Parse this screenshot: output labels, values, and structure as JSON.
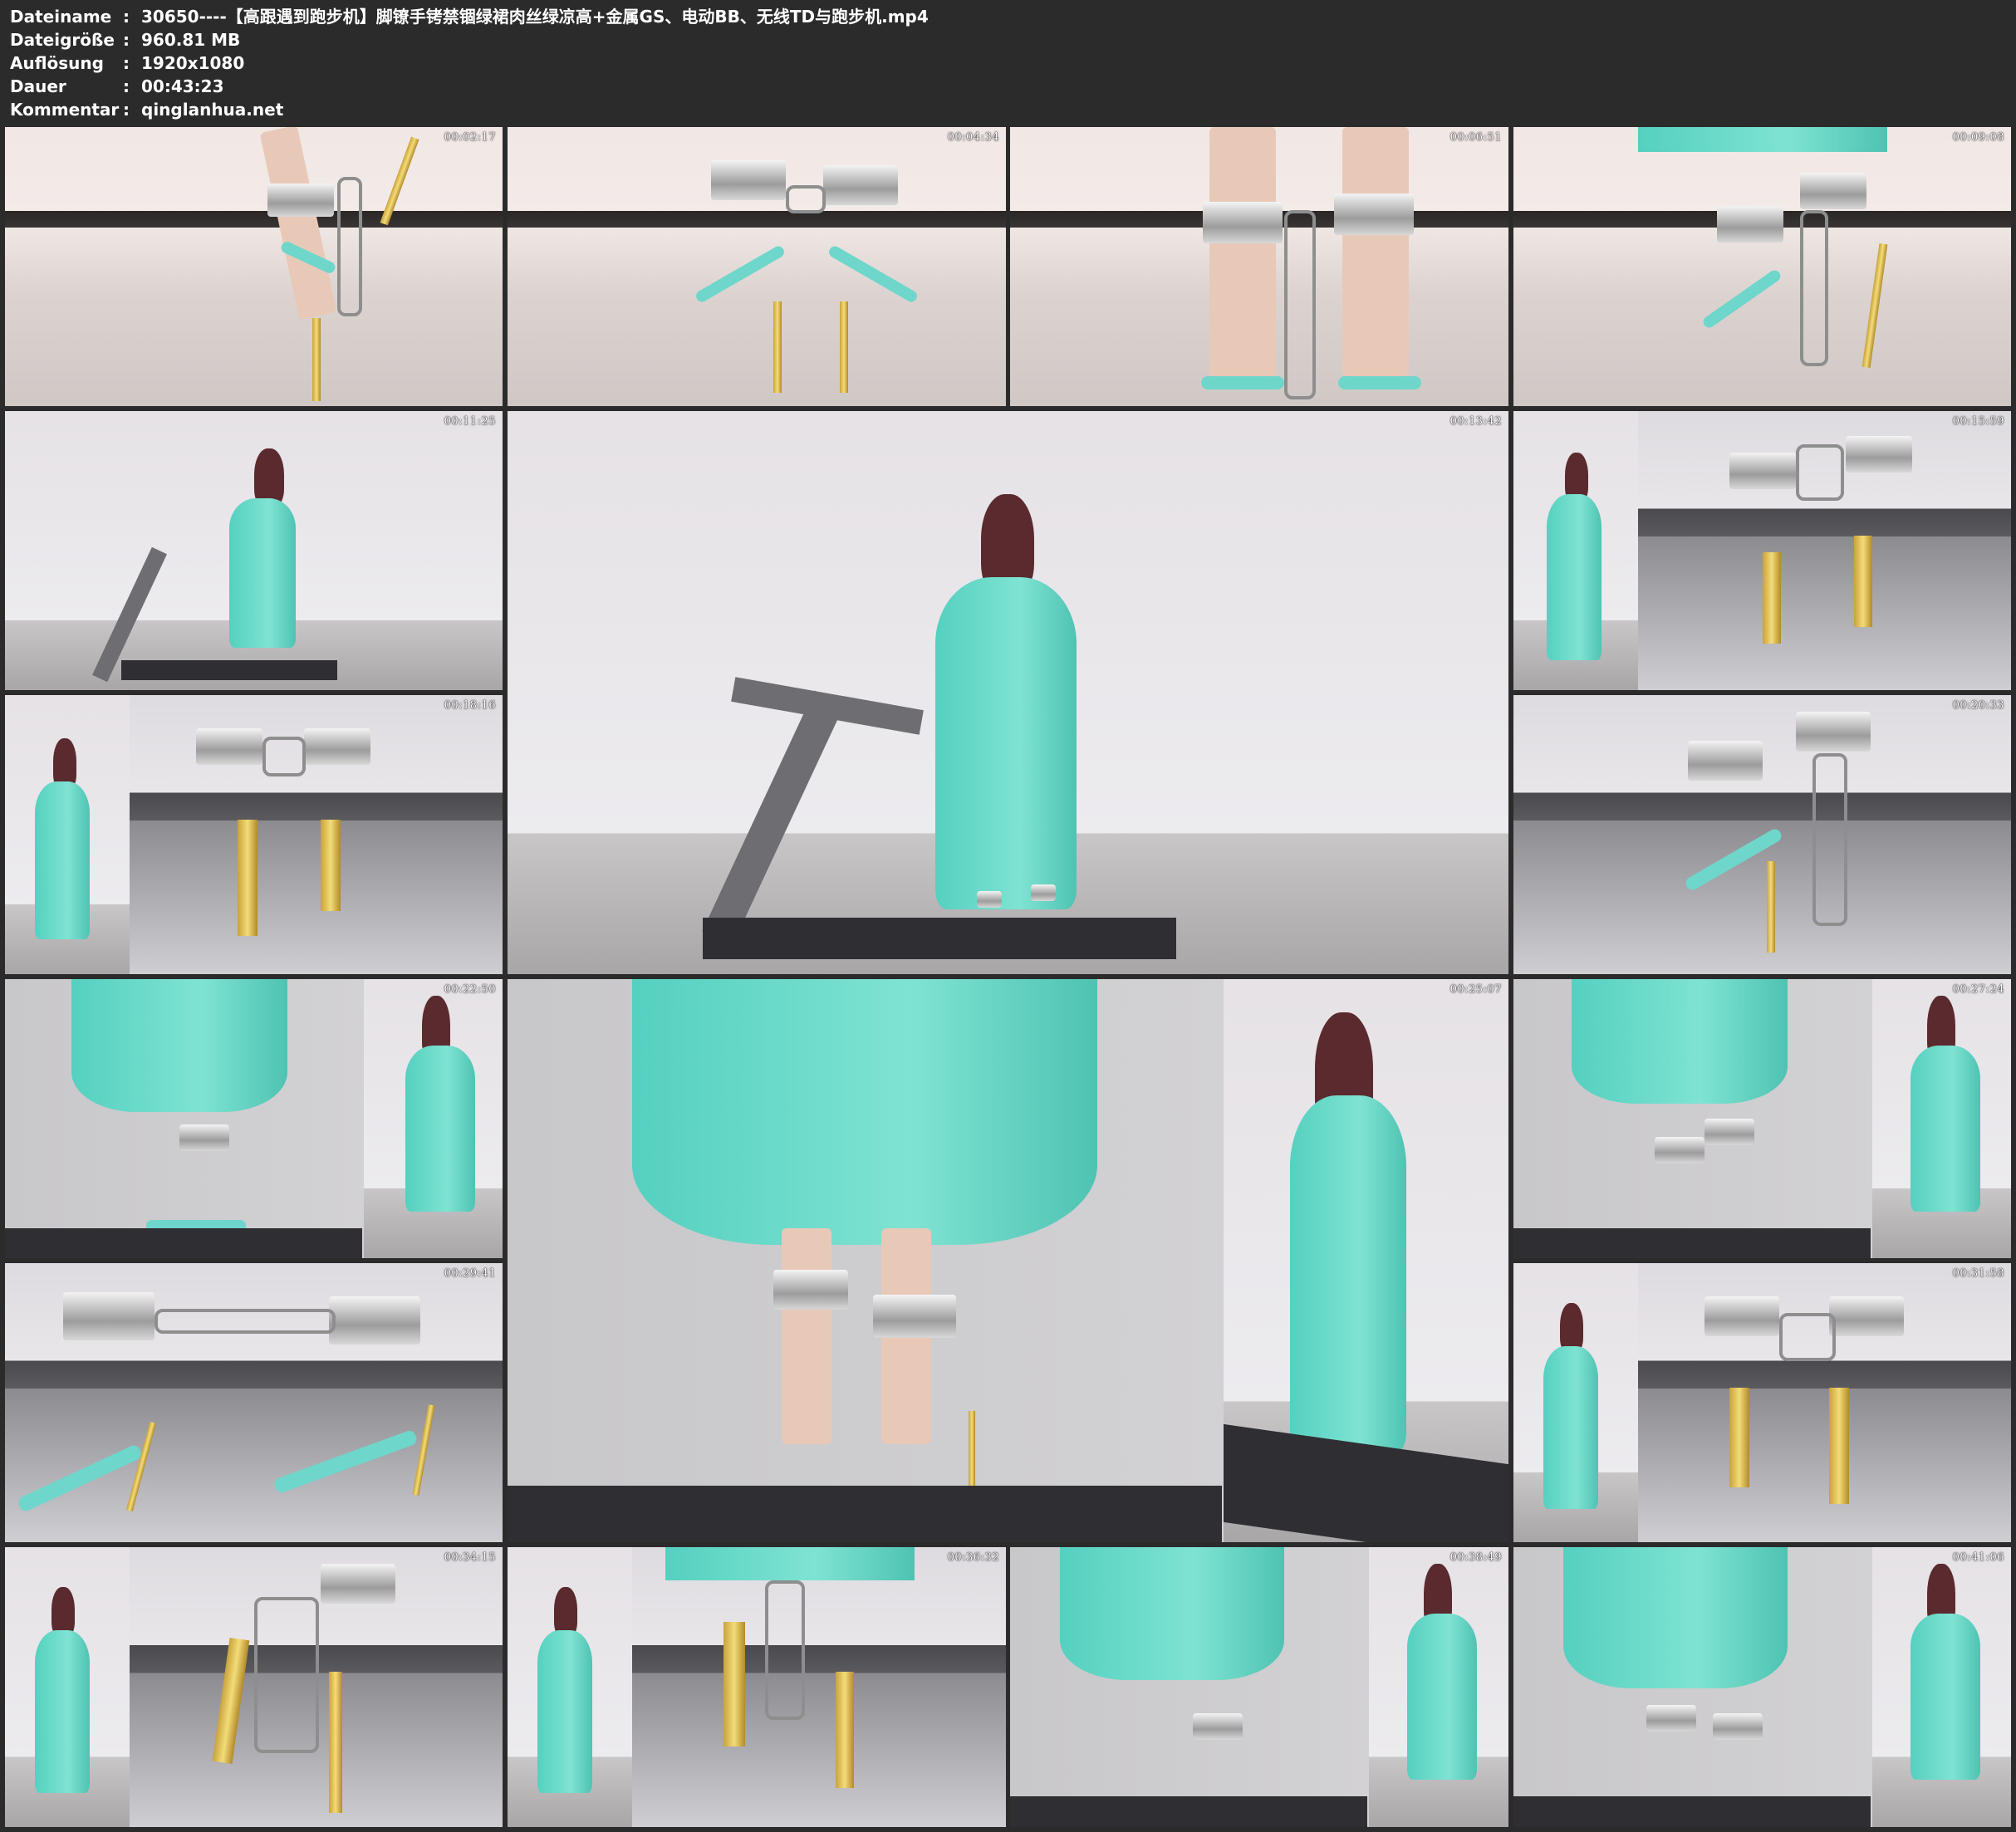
{
  "info": {
    "rows": [
      {
        "key": "Dateiname",
        "sep": ":",
        "value": "30650----【高跟遇到跑步机】脚镣手铐禁锢绿裙肉丝绿凉高+金属GS、电动BB、无线TD与跑步机.mp4"
      },
      {
        "key": "Dateigröße",
        "sep": ":",
        "value": "960.81 MB"
      },
      {
        "key": "Auflösung",
        "sep": ":",
        "value": "1920x1080"
      },
      {
        "key": "Dauer",
        "sep": ":",
        "value": "00:43:23"
      },
      {
        "key": "Kommentar",
        "sep": ":",
        "value": "qinglanhua.net"
      }
    ]
  },
  "thumbnails": [
    {
      "timestamp": "00:02:17"
    },
    {
      "timestamp": "00:04:34"
    },
    {
      "timestamp": "00:06:51"
    },
    {
      "timestamp": "00:09:08"
    },
    {
      "timestamp": "00:11:25"
    },
    {
      "timestamp": "00:13:42"
    },
    {
      "timestamp": "00:15:59"
    },
    {
      "timestamp": "00:18:16"
    },
    {
      "timestamp": "00:20:33"
    },
    {
      "timestamp": "00:22:50"
    },
    {
      "timestamp": "00:25:07"
    },
    {
      "timestamp": "00:27:24"
    },
    {
      "timestamp": "00:29:41"
    },
    {
      "timestamp": "00:31:58"
    },
    {
      "timestamp": "00:34:15"
    },
    {
      "timestamp": "00:36:32"
    },
    {
      "timestamp": "00:38:49"
    },
    {
      "timestamp": "00:41:06"
    }
  ]
}
